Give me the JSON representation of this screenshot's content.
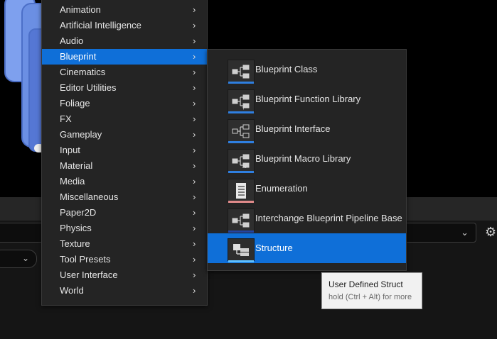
{
  "menu": {
    "items": [
      {
        "label": "Animation"
      },
      {
        "label": "Artificial Intelligence"
      },
      {
        "label": "Audio"
      },
      {
        "label": "Blueprint",
        "active": true
      },
      {
        "label": "Cinematics"
      },
      {
        "label": "Editor Utilities"
      },
      {
        "label": "Foliage"
      },
      {
        "label": "FX"
      },
      {
        "label": "Gameplay"
      },
      {
        "label": "Input"
      },
      {
        "label": "Material"
      },
      {
        "label": "Media"
      },
      {
        "label": "Miscellaneous"
      },
      {
        "label": "Paper2D"
      },
      {
        "label": "Physics"
      },
      {
        "label": "Texture"
      },
      {
        "label": "Tool Presets"
      },
      {
        "label": "User Interface"
      },
      {
        "label": "World"
      }
    ],
    "arrow_glyph": "›",
    "active_color": "#0f6fd8"
  },
  "submenu": {
    "items": [
      {
        "label": "Blueprint Class",
        "icon": "blueprint-class-icon",
        "accent": "#2f7fe0"
      },
      {
        "label": "Blueprint Function Library",
        "icon": "blueprint-function-library-icon",
        "accent": "#2f7fe0"
      },
      {
        "label": "Blueprint Interface",
        "icon": "blueprint-interface-icon",
        "accent": "#2f7fe0"
      },
      {
        "label": "Blueprint Macro Library",
        "icon": "blueprint-macro-library-icon",
        "accent": "#2f7fe0"
      },
      {
        "label": "Enumeration",
        "icon": "enumeration-icon",
        "accent": "#e08a8a"
      },
      {
        "label": "Interchange Blueprint Pipeline Base",
        "icon": "interchange-pipeline-icon",
        "accent": "#2444a0"
      },
      {
        "label": "Structure",
        "icon": "structure-icon",
        "accent": "#5fc0ff",
        "active": true
      }
    ]
  },
  "tooltip": {
    "title": "User Defined Struct",
    "hint": "hold (Ctrl + Alt) for more"
  }
}
